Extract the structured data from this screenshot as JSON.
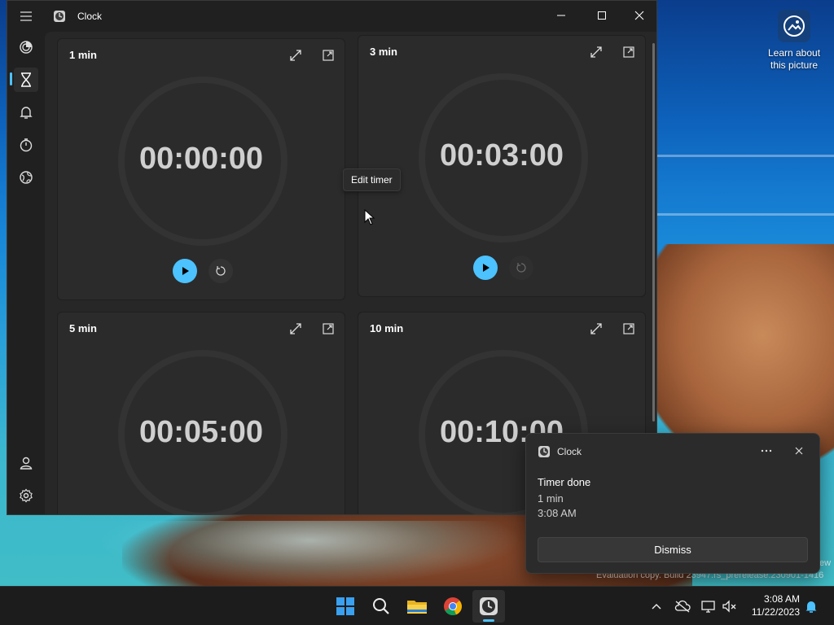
{
  "window": {
    "title": "Clock",
    "controls": [
      "minimize",
      "maximize",
      "close"
    ]
  },
  "nav": {
    "items": [
      {
        "icon": "focus-icon"
      },
      {
        "icon": "timer-icon",
        "active": true
      },
      {
        "icon": "alarm-icon"
      },
      {
        "icon": "stopwatch-icon"
      },
      {
        "icon": "world-clock-icon"
      }
    ],
    "bottom": [
      {
        "icon": "account-icon"
      },
      {
        "icon": "settings-icon"
      }
    ]
  },
  "timers": [
    {
      "name": "1 min",
      "time": "00:00:00",
      "reset_enabled": true
    },
    {
      "name": "3 min",
      "time": "00:03:00",
      "reset_enabled": false
    },
    {
      "name": "5 min",
      "time": "00:05:00"
    },
    {
      "name": "10 min",
      "time": "00:10:00"
    }
  ],
  "tooltip": "Edit timer",
  "desktop": {
    "learn_label": "Learn about this picture",
    "watermark": "Evaluation copy. Build 23947.rs_prerelease.230901-1416",
    "watermark_edge": "ew"
  },
  "toast": {
    "app": "Clock",
    "title": "Timer done",
    "line1": "1 min",
    "line2": "3:08 AM",
    "dismiss": "Dismiss"
  },
  "taskbar": {
    "apps": [
      "start-icon",
      "search-icon",
      "file-explorer-icon",
      "chrome-icon",
      "clock-app-icon"
    ],
    "time": "3:08 AM",
    "date": "11/22/2023"
  },
  "colors": {
    "accent": "#4cc2ff",
    "window_bg": "#202020",
    "card_bg": "#2b2b2b"
  }
}
